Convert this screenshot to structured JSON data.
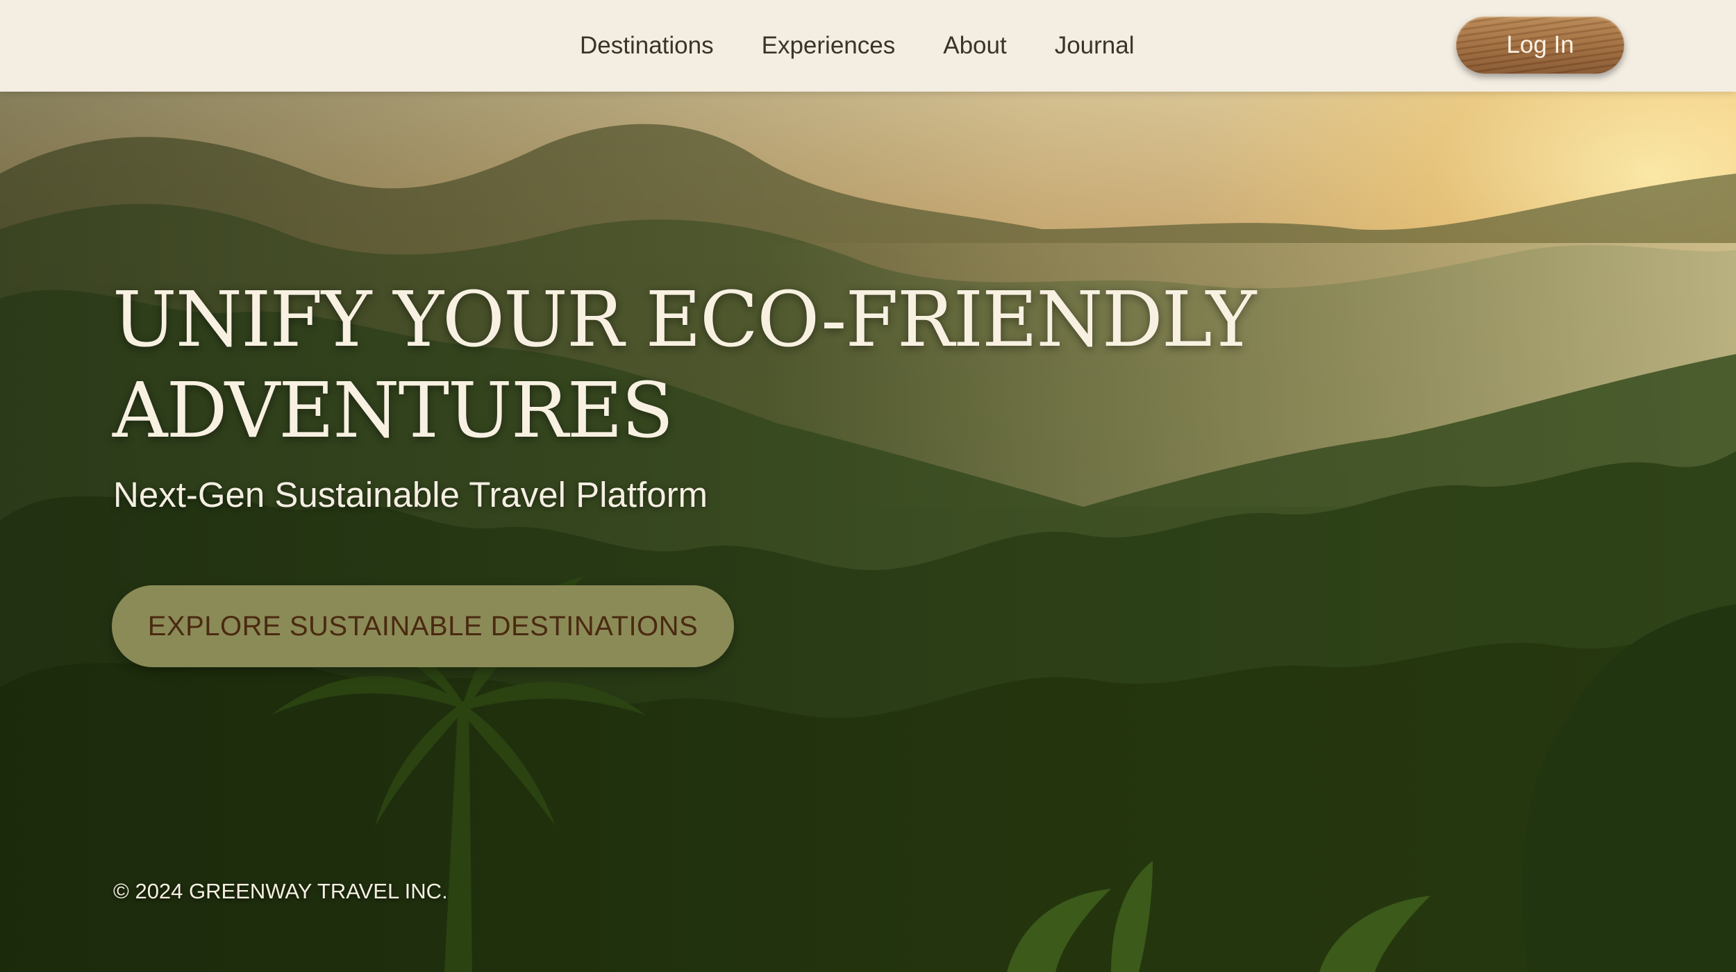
{
  "nav": {
    "items": [
      {
        "label": "Destinations"
      },
      {
        "label": "Experiences"
      },
      {
        "label": "About"
      },
      {
        "label": "Journal"
      }
    ],
    "login_label": "Log In"
  },
  "hero": {
    "title_line1": "UNIFY YOUR ECO-FRIENDLY",
    "title_line2": "ADVENTURES",
    "subtitle": "Next-Gen Sustainable Travel Platform",
    "cta_label": "EXPLORE SUSTAINABLE DESTINATIONS",
    "background": "misty-rainforest-sunrise-image"
  },
  "footer": {
    "copyright": "© 2024 GREENWAY TRAVEL INC."
  },
  "colors": {
    "navbar_bg": "#f3ede2",
    "nav_text": "#3b3326",
    "login_button": "#9c6a3d",
    "cta_button": "#8b8b58",
    "cta_text": "#4a2a10",
    "hero_text": "#f8f1e2"
  }
}
